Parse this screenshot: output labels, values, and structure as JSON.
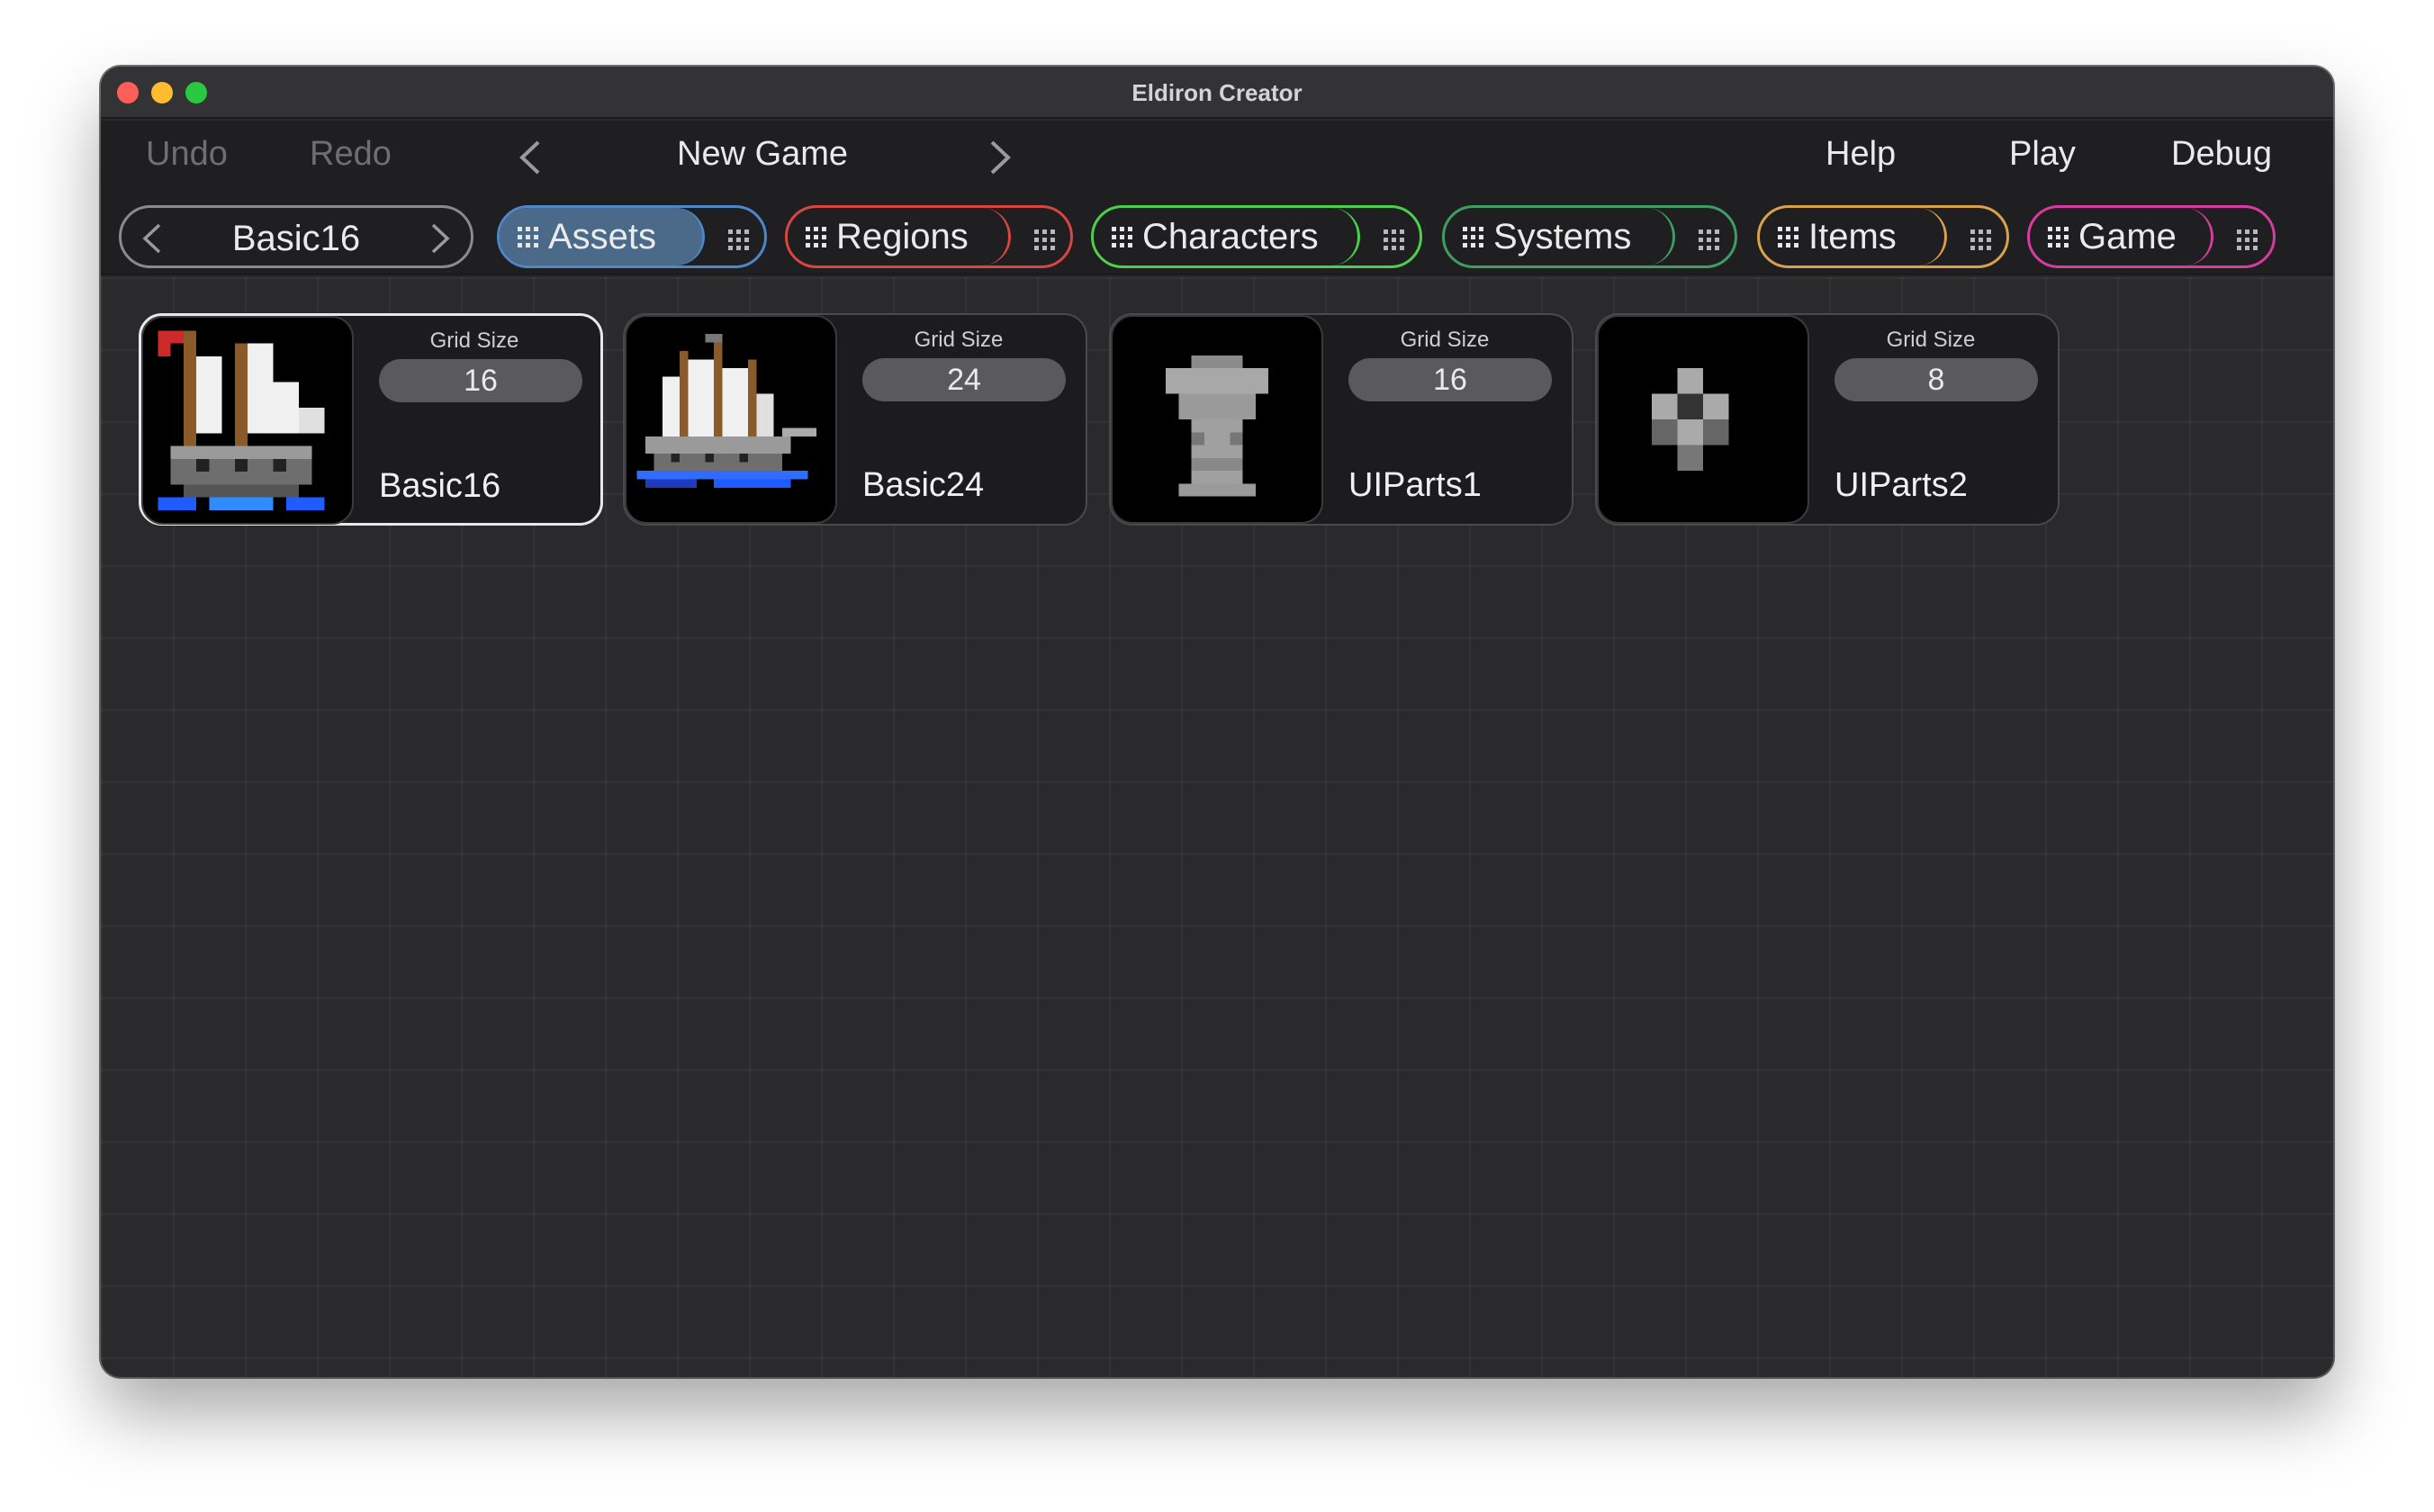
{
  "window": {
    "title": "Eldiron Creator"
  },
  "menubar": {
    "undo": "Undo",
    "redo": "Redo",
    "project_name": "New Game",
    "help": "Help",
    "play": "Play",
    "debug": "Debug"
  },
  "tileset_selector": {
    "label": "Basic16"
  },
  "tabs": [
    {
      "label": "Assets",
      "color": "#4f86c6",
      "active": true
    },
    {
      "label": "Regions",
      "color": "#d9463f",
      "active": false
    },
    {
      "label": "Characters",
      "color": "#4ccf4a",
      "active": false
    },
    {
      "label": "Systems",
      "color": "#3f9d63",
      "active": false
    },
    {
      "label": "Items",
      "color": "#d8a14a",
      "active": false
    },
    {
      "label": "Game",
      "color": "#d63ca0",
      "active": false
    }
  ],
  "assets": [
    {
      "name": "Basic16",
      "grid_size_label": "Grid Size",
      "grid_size": "16",
      "selected": true,
      "thumb": "ship-small-icon"
    },
    {
      "name": "Basic24",
      "grid_size_label": "Grid Size",
      "grid_size": "24",
      "selected": false,
      "thumb": "ship-large-icon"
    },
    {
      "name": "UIParts1",
      "grid_size_label": "Grid Size",
      "grid_size": "16",
      "selected": false,
      "thumb": "ui-part-icon"
    },
    {
      "name": "UIParts2",
      "grid_size_label": "Grid Size",
      "grid_size": "8",
      "selected": false,
      "thumb": "diamond-icon"
    }
  ]
}
